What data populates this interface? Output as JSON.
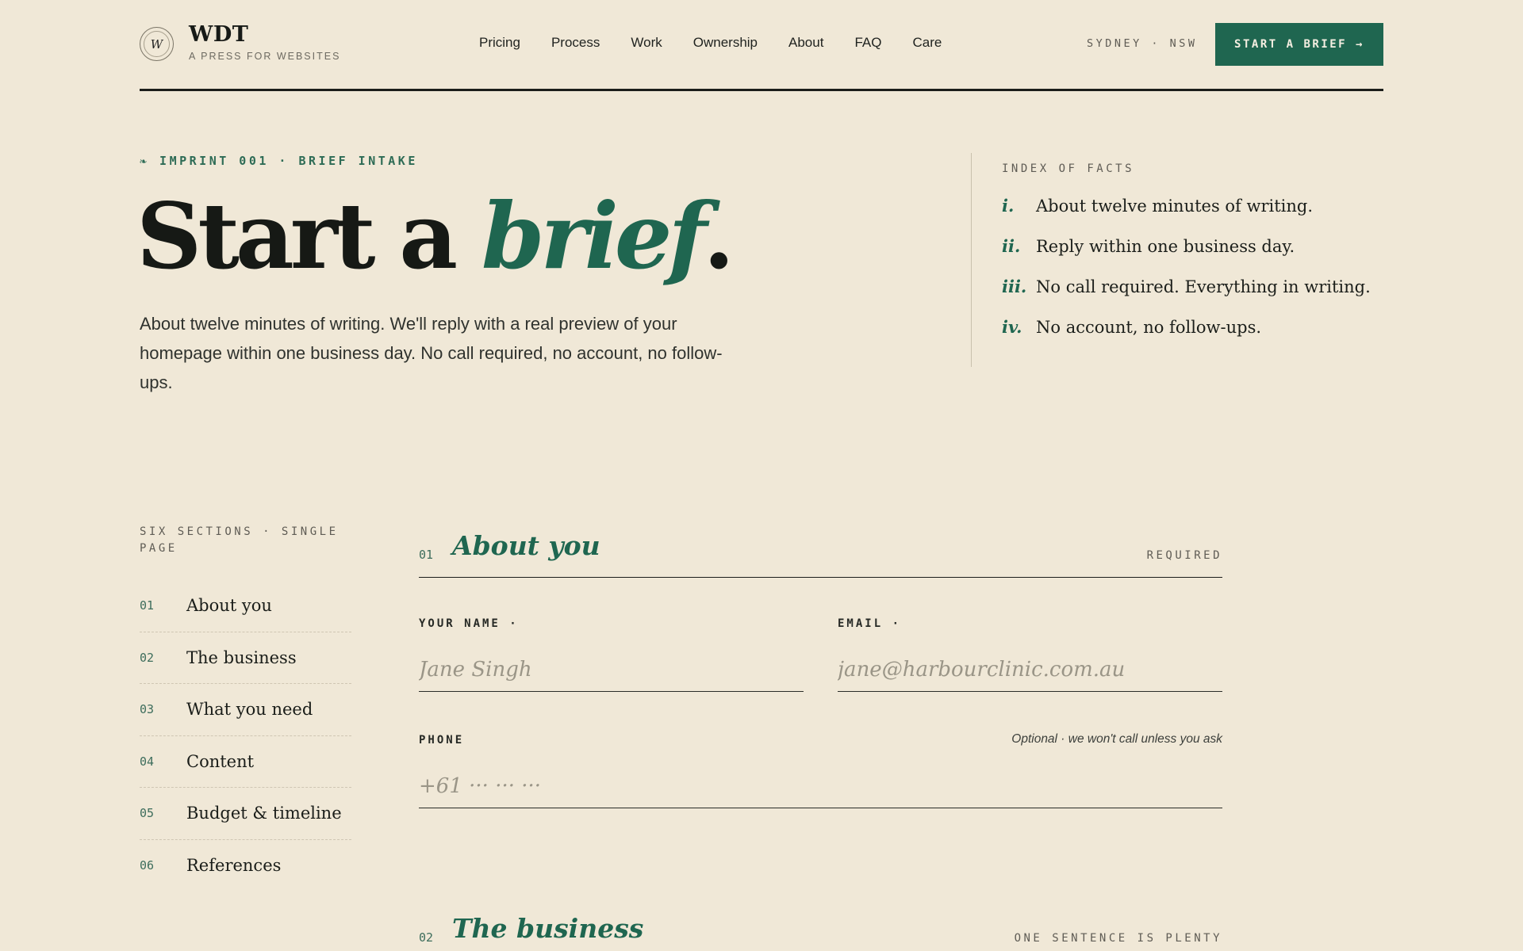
{
  "header": {
    "logo_glyph": "W",
    "brand_name": "WDT",
    "brand_tagline": "A PRESS FOR WEBSITES",
    "nav": [
      "Pricing",
      "Process",
      "Work",
      "Ownership",
      "About",
      "FAQ",
      "Care"
    ],
    "location": "SYDNEY · NSW",
    "cta_label": "START A BRIEF →"
  },
  "hero": {
    "eyebrow": "❧ IMPRINT 001 · BRIEF INTAKE",
    "title_plain": "Start a ",
    "title_accent": "brief",
    "title_end": ".",
    "lede": "About twelve minutes of writing. We'll reply with a real preview of your homepage within one business day. No call required, no account, no follow-ups."
  },
  "facts": {
    "title": "INDEX OF FACTS",
    "items": [
      {
        "num": "i.",
        "text": "About twelve minutes of writing."
      },
      {
        "num": "ii.",
        "text": "Reply within one business day."
      },
      {
        "num": "iii.",
        "text": "No call required. Everything in writing."
      },
      {
        "num": "iv.",
        "text": "No account, no follow-ups."
      }
    ]
  },
  "sidebar": {
    "title": "SIX SECTIONS · SINGLE PAGE",
    "items": [
      {
        "num": "01",
        "label": "About you"
      },
      {
        "num": "02",
        "label": "The business"
      },
      {
        "num": "03",
        "label": "What you need"
      },
      {
        "num": "04",
        "label": "Content"
      },
      {
        "num": "05",
        "label": "Budget & timeline"
      },
      {
        "num": "06",
        "label": "References"
      }
    ]
  },
  "form": {
    "section1": {
      "num": "01",
      "title": "About you",
      "meta": "REQUIRED"
    },
    "name": {
      "label": "YOUR NAME ·",
      "placeholder": "Jane Singh"
    },
    "email": {
      "label": "EMAIL ·",
      "placeholder": "jane@harbourclinic.com.au"
    },
    "phone": {
      "label": "PHONE",
      "hint": "Optional · we won't call unless you ask",
      "placeholder": "+61 ··· ··· ···"
    },
    "section2": {
      "num": "02",
      "title": "The business",
      "meta": "ONE SENTENCE IS PLENTY"
    }
  },
  "colors": {
    "background": "#f0e8d7",
    "accent": "#1f6650",
    "ink": "#171a17"
  }
}
